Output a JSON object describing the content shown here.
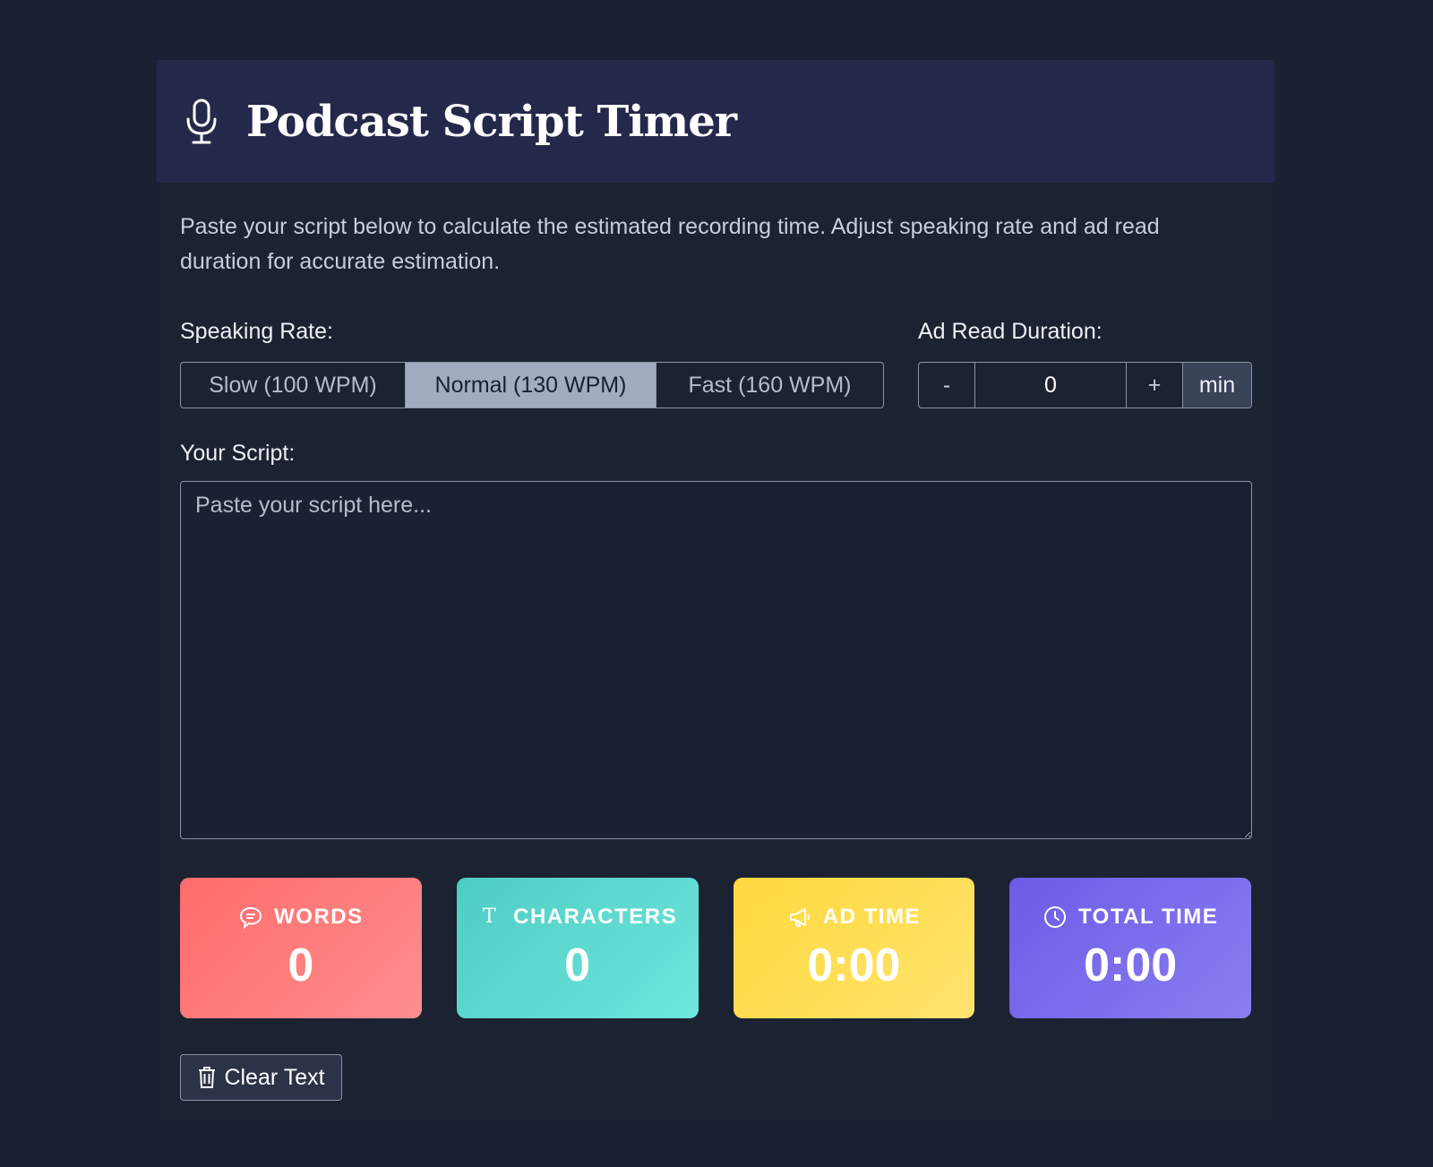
{
  "header": {
    "title": "Podcast Script Timer",
    "icon": "microphone-icon"
  },
  "description": "Paste your script below to calculate the estimated recording time. Adjust speaking rate and ad read duration for accurate estimation.",
  "speaking_rate": {
    "label": "Speaking Rate:",
    "options": [
      "Slow (100 WPM)",
      "Normal (130 WPM)",
      "Fast (160 WPM)"
    ],
    "selected": "Normal (130 WPM)"
  },
  "ad_read": {
    "label": "Ad Read Duration:",
    "minus": "-",
    "value": "0",
    "plus": "+",
    "unit": "min"
  },
  "script": {
    "label": "Your Script:",
    "placeholder": "Paste your script here...",
    "value": ""
  },
  "stats": {
    "words": {
      "label": "WORDS",
      "value": "0",
      "icon": "comment-icon",
      "color": "#ff6b6b"
    },
    "characters": {
      "label": "CHARACTERS",
      "value": "0",
      "icon": "text-icon",
      "color": "#4ecdc4"
    },
    "ad_time": {
      "label": "AD TIME",
      "value": "0:00",
      "icon": "megaphone-icon",
      "color": "#ffd93d"
    },
    "total_time": {
      "label": "TOTAL TIME",
      "value": "0:00",
      "icon": "clock-icon",
      "color": "#6c5ce7"
    }
  },
  "clear_button": {
    "label": "Clear Text",
    "icon": "trash-icon"
  }
}
